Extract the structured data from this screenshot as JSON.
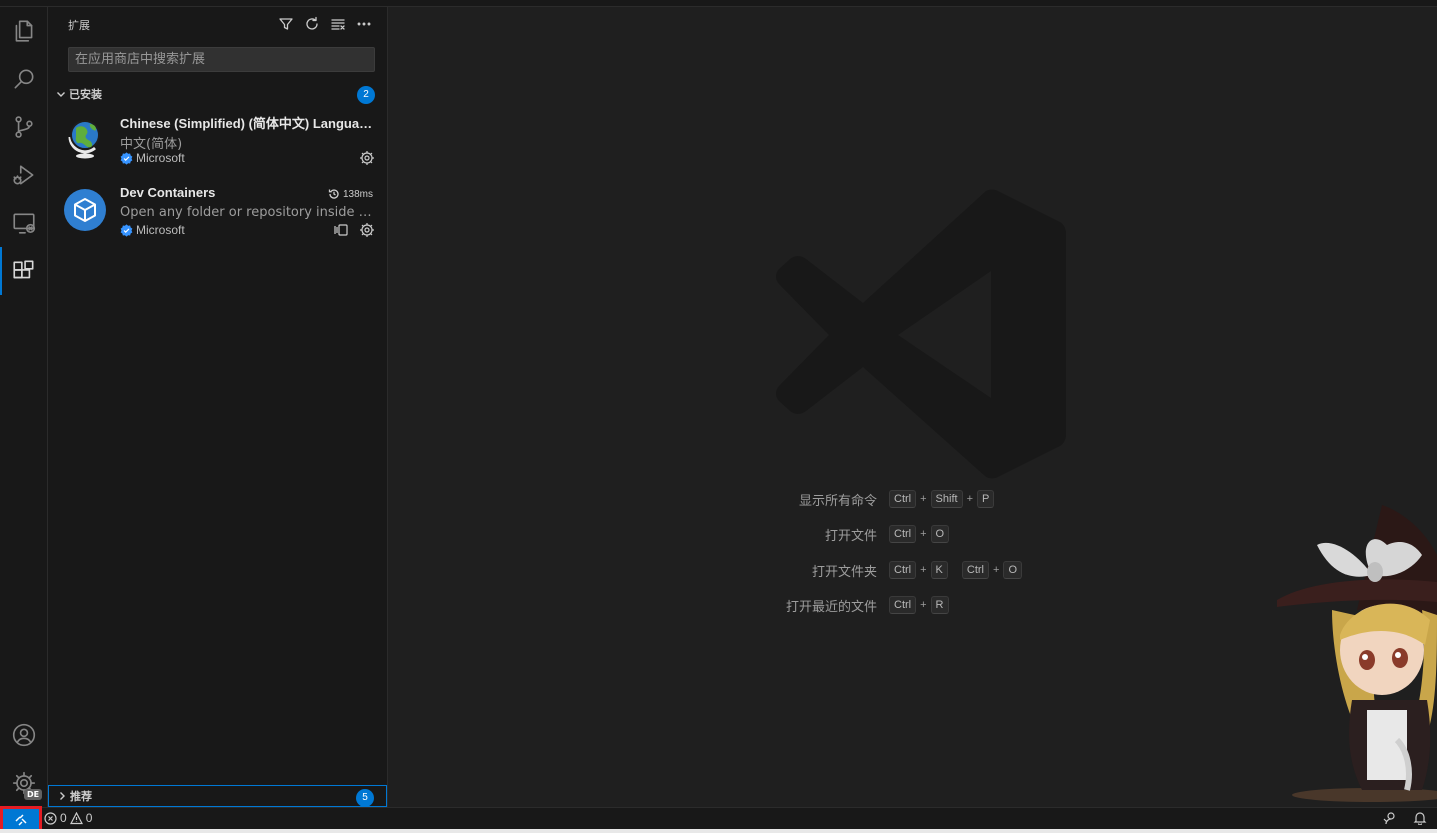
{
  "sidebar": {
    "title": "扩展",
    "search_placeholder": "在应用商店中搜索扩展",
    "installed": {
      "label": "已安装",
      "count": "2",
      "items": [
        {
          "name": "Chinese (Simplified) (简体中文) Language Pack for Visual Studio Code",
          "description": "中文(简体)",
          "publisher": "Microsoft",
          "icon": "globe-icon"
        },
        {
          "name": "Dev Containers",
          "description": "Open any folder or repository inside a Docker container and take advantage of Visual Studio Code's full feature set.",
          "publisher": "Microsoft",
          "timing": "138ms",
          "icon": "cube-icon"
        }
      ]
    },
    "recommended": {
      "label": "推荐",
      "count": "5"
    }
  },
  "editor": {
    "shortcuts": [
      {
        "label": "显示所有命令",
        "keys": [
          "Ctrl",
          "Shift",
          "P"
        ]
      },
      {
        "label": "打开文件",
        "keys": [
          "Ctrl",
          "O"
        ]
      },
      {
        "label": "打开文件夹",
        "keys": [
          "Ctrl",
          "K"
        ],
        "keys2": [
          "Ctrl",
          "O"
        ]
      },
      {
        "label": "打开最近的文件",
        "keys": [
          "Ctrl",
          "R"
        ]
      }
    ]
  },
  "statusbar": {
    "errors": "0",
    "warnings": "0"
  },
  "activitybar": {
    "account_badge": "DE"
  },
  "colors": {
    "accent": "#0078d4",
    "highlight": "#e51c23"
  }
}
